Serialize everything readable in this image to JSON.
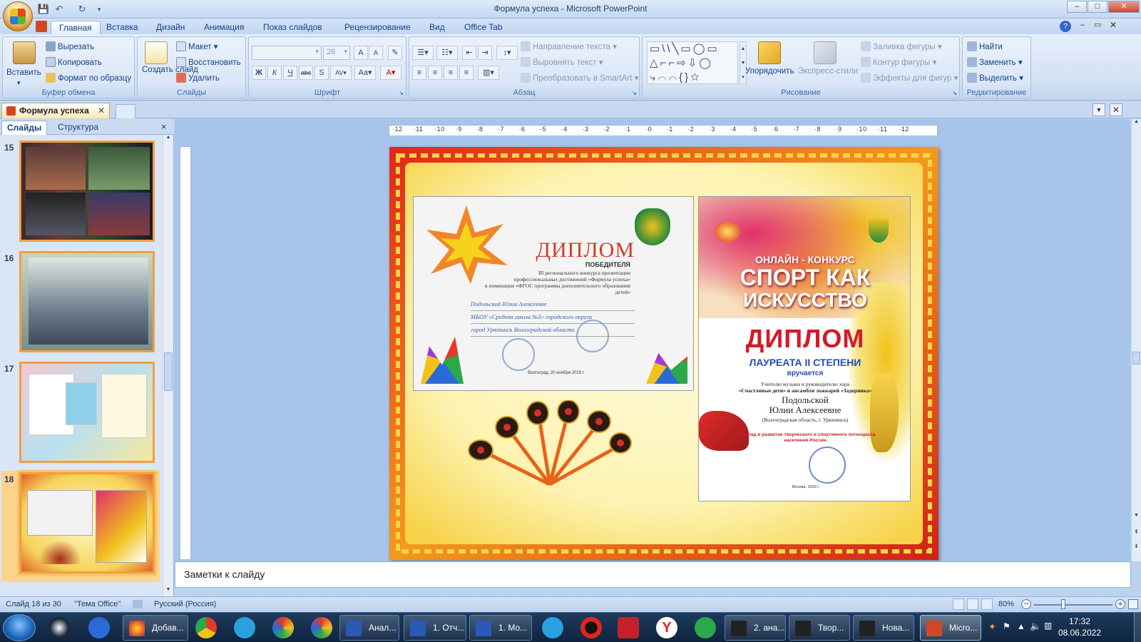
{
  "window": {
    "title": "Формула успеха - Microsoft PowerPoint",
    "minimize": "–",
    "maximize": "□",
    "close": "✕"
  },
  "ribbon_tabs": [
    "Главная",
    "Вставка",
    "Дизайн",
    "Анимация",
    "Показ слайдов",
    "Рецензирование",
    "Вид",
    "Office Tab"
  ],
  "ribbon": {
    "clipboard": {
      "label": "Буфер обмена",
      "paste": "Вставить",
      "cut": "Вырезать",
      "copy": "Копировать",
      "format_painter": "Формат по образцу"
    },
    "slides": {
      "label": "Слайды",
      "new_slide": "Создать слайд",
      "layout": "Макет",
      "reset": "Восстановить",
      "delete": "Удалить"
    },
    "font": {
      "label": "Шрифт",
      "size": "28"
    },
    "paragraph": {
      "label": "Абзац",
      "text_direction": "Направление текста",
      "align_text": "Выровнять текст",
      "smartart": "Преобразовать в SmartArt"
    },
    "drawing": {
      "label": "Рисование",
      "arrange": "Упорядочить",
      "quick_styles": "Экспресс-стили",
      "shape_fill": "Заливка фигуры",
      "shape_outline": "Контур фигуры",
      "shape_effects": "Эффекты для фигур"
    },
    "editing": {
      "label": "Редактирование",
      "find": "Найти",
      "replace": "Заменить",
      "select": "Выделить"
    }
  },
  "doc_tab": {
    "name": "Формула успеха"
  },
  "left_panel": {
    "tabs": [
      "Слайды",
      "Структура"
    ],
    "close": "×",
    "slides": [
      {
        "number": "15"
      },
      {
        "number": "16"
      },
      {
        "number": "17"
      },
      {
        "number": "18"
      }
    ]
  },
  "ruler": {
    "ticks": [
      "12",
      "11",
      "10",
      "9",
      "8",
      "7",
      "6",
      "5",
      "4",
      "3",
      "2",
      "1",
      "0",
      "1",
      "2",
      "3",
      "4",
      "5",
      "6",
      "7",
      "8",
      "9",
      "10",
      "11",
      "12"
    ]
  },
  "slide": {
    "diploma1": {
      "title": "ДИПЛОМ",
      "subtitle": "ПОБЕДИТЕЛЯ",
      "line1": "III регионального конкурса презентации",
      "line2": "профессиональных достижений «Формула успеха»",
      "line3": "в номинации «ФГОС программы дополнительного образования детей»",
      "hand1": "Подольской Юлии Алексеевне",
      "hand2": "МБОУ «Средняя школа №3» городского округа",
      "hand3": "город Урюпинск Волгоградской области",
      "footer": "Волгоград, 20 ноября 2019 г."
    },
    "diploma2": {
      "header": "ОНЛАЙН - КОНКУРС",
      "title1": "СПОРТ КАК",
      "title2": "ИСКУССТВО",
      "diploma": "ДИПЛОМ",
      "degree": "ЛАУРЕАТА II СТЕПЕНИ",
      "awarded": "вручается",
      "teacher": "Учителю музыки и руководителю хора",
      "choir": "«Счастливые дети» и ансамбля ложкарей «Задоринка»",
      "name1": "Подольской",
      "name2": "Юлии Алексеевне",
      "region": "(Волгоградская область, г. Урюпинск)",
      "contribution": "за вклад в развитие творческого и спортивного потенциала населения России.",
      "city": "Москва, 2020 г."
    }
  },
  "notes": {
    "placeholder": "Заметки к слайду"
  },
  "status": {
    "slide": "Слайд 18 из 30",
    "theme": "\"Тема Office\"",
    "language": "Русский (Россия)",
    "zoom": "80%"
  },
  "taskbar": {
    "items": [
      {
        "label": "Добав..."
      },
      {
        "label": "Анал..."
      },
      {
        "label": "1. Отч..."
      },
      {
        "label": "1. Мо..."
      },
      {
        "label": "2. ана..."
      },
      {
        "label": "Твор..."
      },
      {
        "label": "Нова..."
      },
      {
        "label": "Micro..."
      }
    ],
    "time": "17:32",
    "date": "08.06.2022"
  }
}
